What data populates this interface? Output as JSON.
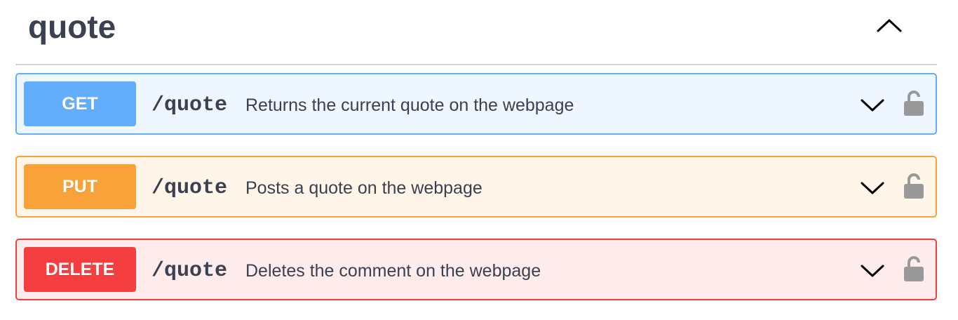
{
  "tag": {
    "title": "quote",
    "expanded": true,
    "toggle_icon": "chevron-up-icon"
  },
  "operations": [
    {
      "method": "GET",
      "path": "/quote",
      "summary": "Returns the current quote on the webpage",
      "color": "#62aefd",
      "background": "#eef6ff",
      "expand_icon": "chevron-down-icon",
      "lock_icon": "lock-icon"
    },
    {
      "method": "PUT",
      "path": "/quote",
      "summary": "Posts a quote on the webpage",
      "color": "#f9a23a",
      "background": "#fff5e9",
      "expand_icon": "chevron-down-icon",
      "lock_icon": "lock-icon"
    },
    {
      "method": "DELETE",
      "path": "/quote",
      "summary": "Deletes the comment on the webpage",
      "color": "#f43e3f",
      "background": "#feebeb",
      "expand_icon": "chevron-down-icon",
      "lock_icon": "lock-icon"
    }
  ],
  "colors": {
    "text": "#3b4151",
    "divider": "#d3d5d9",
    "lock": "#999999"
  }
}
